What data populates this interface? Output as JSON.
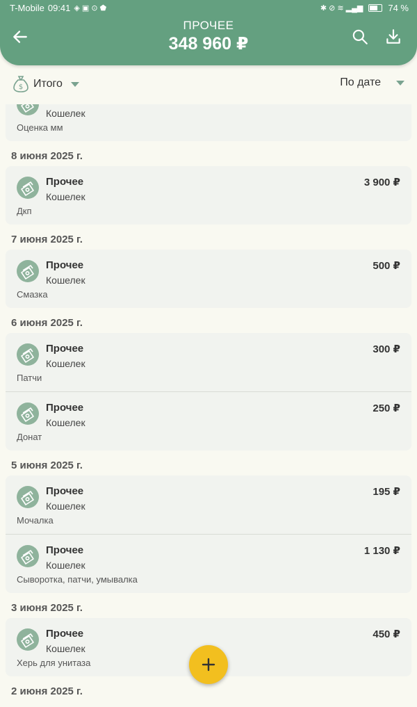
{
  "status": {
    "carrier": "T-Mobile",
    "time": "09:41",
    "battery": "74 %"
  },
  "header": {
    "title": "ПРОЧЕЕ",
    "total": "348 960 ₽"
  },
  "filter": {
    "group_label": "Итого",
    "sort_label": "По дате"
  },
  "partial_entry": {
    "account": "Кошелек",
    "note": "Оценка мм"
  },
  "groups": [
    {
      "date": "8 июня 2025 г.",
      "items": [
        {
          "category": "Прочее",
          "account": "Кошелек",
          "note": "Дкп",
          "amount": "3 900 ₽"
        }
      ]
    },
    {
      "date": "7 июня 2025 г.",
      "items": [
        {
          "category": "Прочее",
          "account": "Кошелек",
          "note": "Смазка",
          "amount": "500 ₽"
        }
      ]
    },
    {
      "date": "6 июня 2025 г.",
      "items": [
        {
          "category": "Прочее",
          "account": "Кошелек",
          "note": "Патчи",
          "amount": "300 ₽"
        },
        {
          "category": "Прочее",
          "account": "Кошелек",
          "note": "Донат",
          "amount": "250 ₽"
        }
      ]
    },
    {
      "date": "5 июня 2025 г.",
      "items": [
        {
          "category": "Прочее",
          "account": "Кошелек",
          "note": "Мочалка",
          "amount": "195 ₽"
        },
        {
          "category": "Прочее",
          "account": "Кошелек",
          "note": "Сыворотка, патчи, умывалка",
          "amount": "1 130 ₽"
        }
      ]
    },
    {
      "date": "3 июня 2025 г.",
      "items": [
        {
          "category": "Прочее",
          "account": "Кошелек",
          "note": "Херь для унитаза",
          "amount": "450 ₽"
        }
      ]
    },
    {
      "date": "2 июня 2025 г.",
      "items": []
    }
  ],
  "colors": {
    "header": "#64a080",
    "background": "#f9f9f1",
    "card": "#f1f3ef",
    "fab": "#f2bf1f",
    "category_icon": "#8fb39c"
  },
  "icons": {
    "back": "arrow-left-icon",
    "search": "search-icon",
    "download": "download-icon",
    "group": "money-bag-icon",
    "category": "cash-icon",
    "fab": "plus-icon"
  }
}
